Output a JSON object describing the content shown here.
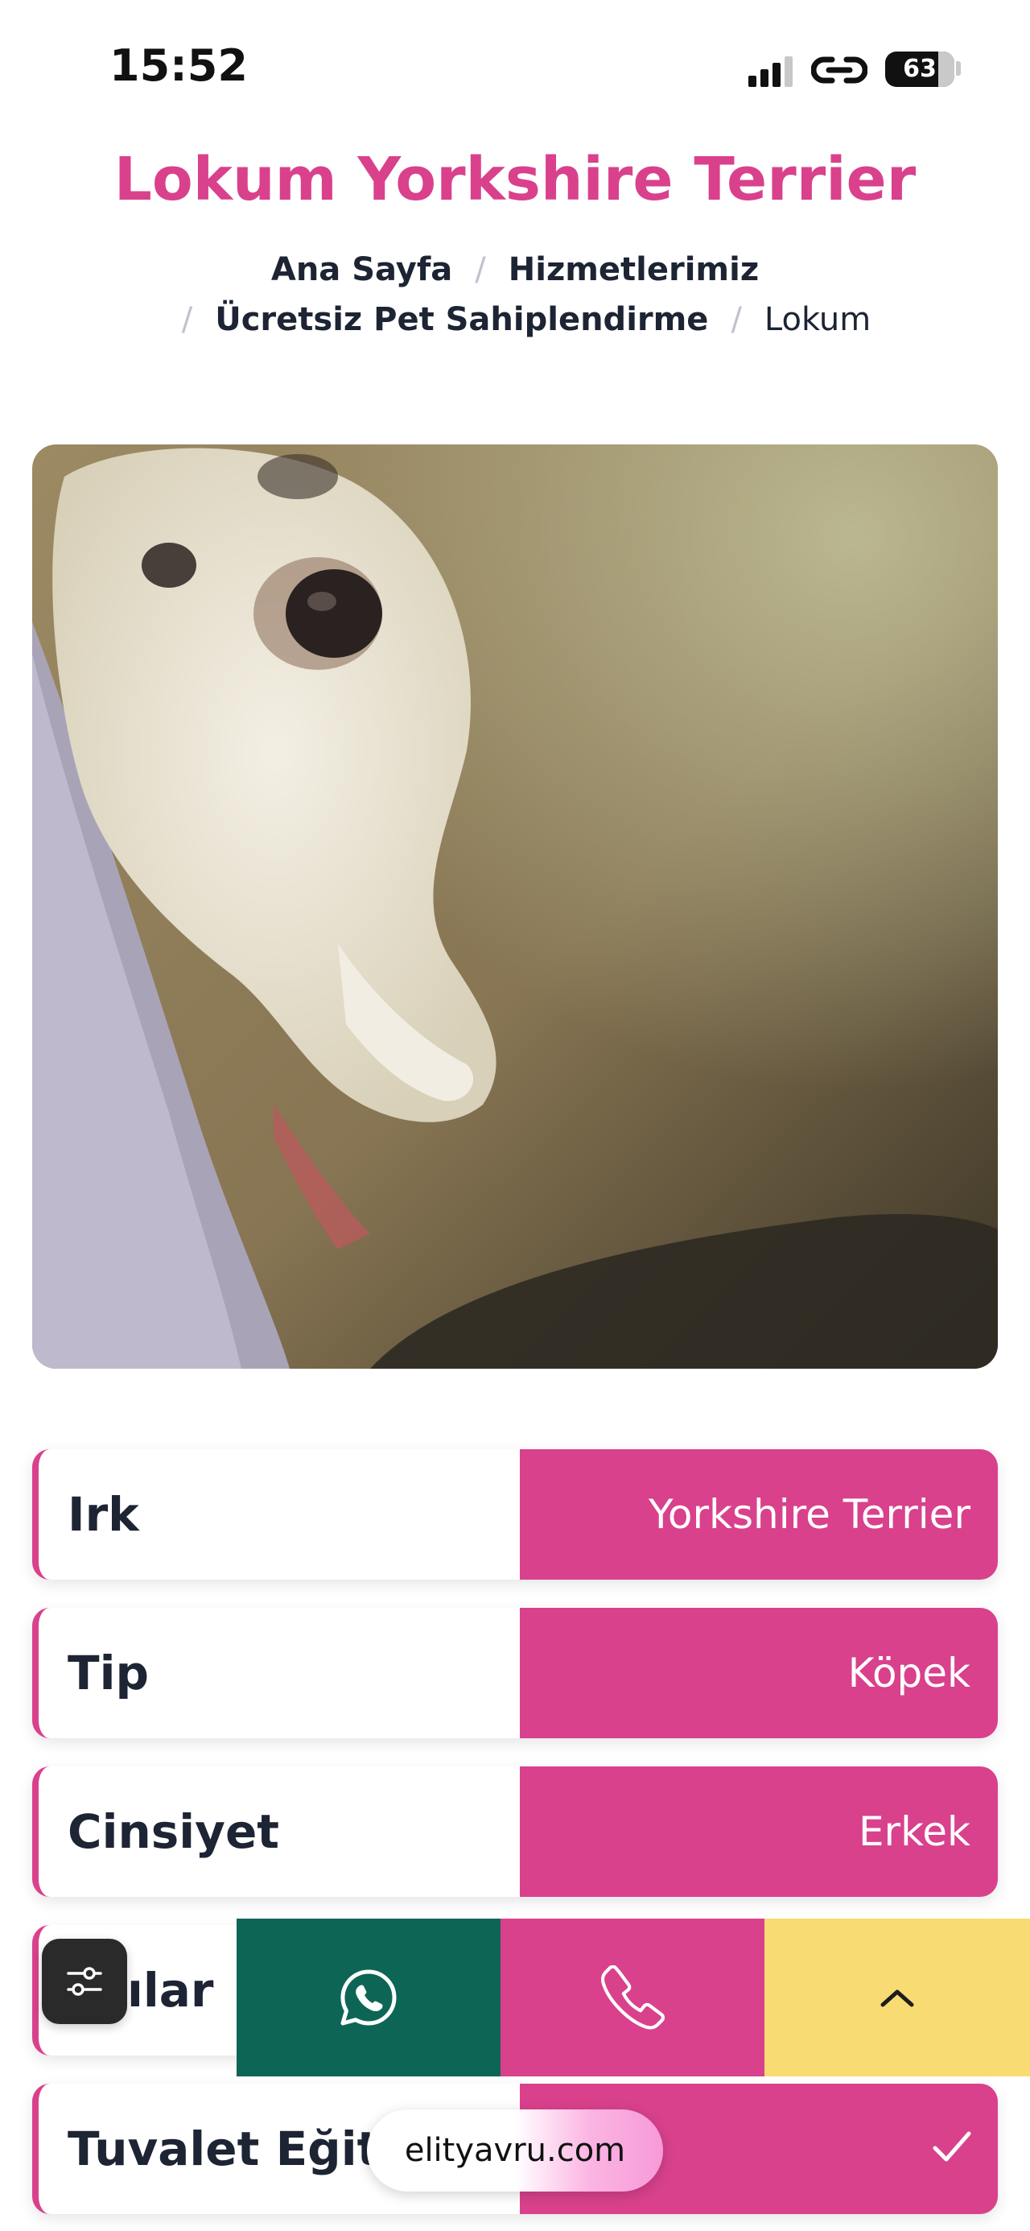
{
  "status_bar": {
    "time": "15:52",
    "battery": "63"
  },
  "page": {
    "title": "Lokum Yorkshire Terrier"
  },
  "breadcrumb": {
    "items": [
      "Ana Sayfa",
      "Hizmetlerimiz",
      "Ücretsiz Pet Sahiplendirme",
      "Lokum"
    ],
    "separator": "/"
  },
  "photo": {
    "alt": "Lokum"
  },
  "details": [
    {
      "label": "Irk",
      "value": "Yorkshire Terrier"
    },
    {
      "label": "Tip",
      "value": "Köpek"
    },
    {
      "label": "Cinsiyet",
      "value": "Erkek"
    },
    {
      "label": "ılar",
      "value": ""
    },
    {
      "label": "Tuvalet Eğiti",
      "value": ""
    }
  ],
  "actions": {
    "whatsapp_icon": "whatsapp-icon",
    "phone_icon": "phone-icon",
    "scroll_top_icon": "chevron-up-icon",
    "settings_icon": "sliders-icon"
  },
  "browser": {
    "url": "elityavru.com"
  },
  "colors": {
    "brand_pink": "#d9418c",
    "whatsapp_green": "#0d6655",
    "scroll_top_yellow": "#f8dc73",
    "text_dark": "#1d2433"
  }
}
